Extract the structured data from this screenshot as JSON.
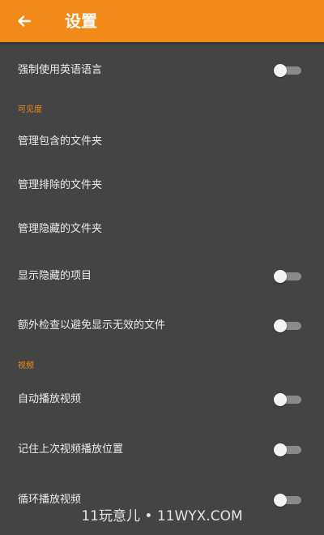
{
  "colors": {
    "accent": "#f28a19",
    "background": "#444444",
    "text": "#ececec",
    "toggle_track": "#8a8a8a",
    "toggle_thumb": "#f3f3f3"
  },
  "appbar": {
    "back_icon": "arrow-left-icon",
    "title": "设置"
  },
  "settings": {
    "force_english": {
      "label": "强制使用英语语言",
      "enabled": false
    },
    "visibility_section": "可见度",
    "manage_included": "管理包含的文件夹",
    "manage_excluded": "管理排除的文件夹",
    "manage_hidden": "管理隐藏的文件夹",
    "show_hidden": {
      "label": "显示隐藏的项目",
      "enabled": false
    },
    "extra_check": {
      "label": "额外检查以避免显示无效的文件",
      "enabled": false
    },
    "video_section": "视频",
    "autoplay_video": {
      "label": "自动播放视频",
      "enabled": false
    },
    "remember_position": {
      "label": "记住上次视频播放位置",
      "enabled": false
    },
    "loop_video": {
      "label": "循环播放视频",
      "enabled": false
    }
  },
  "watermark": "11玩意儿 • 11WYX.COM"
}
